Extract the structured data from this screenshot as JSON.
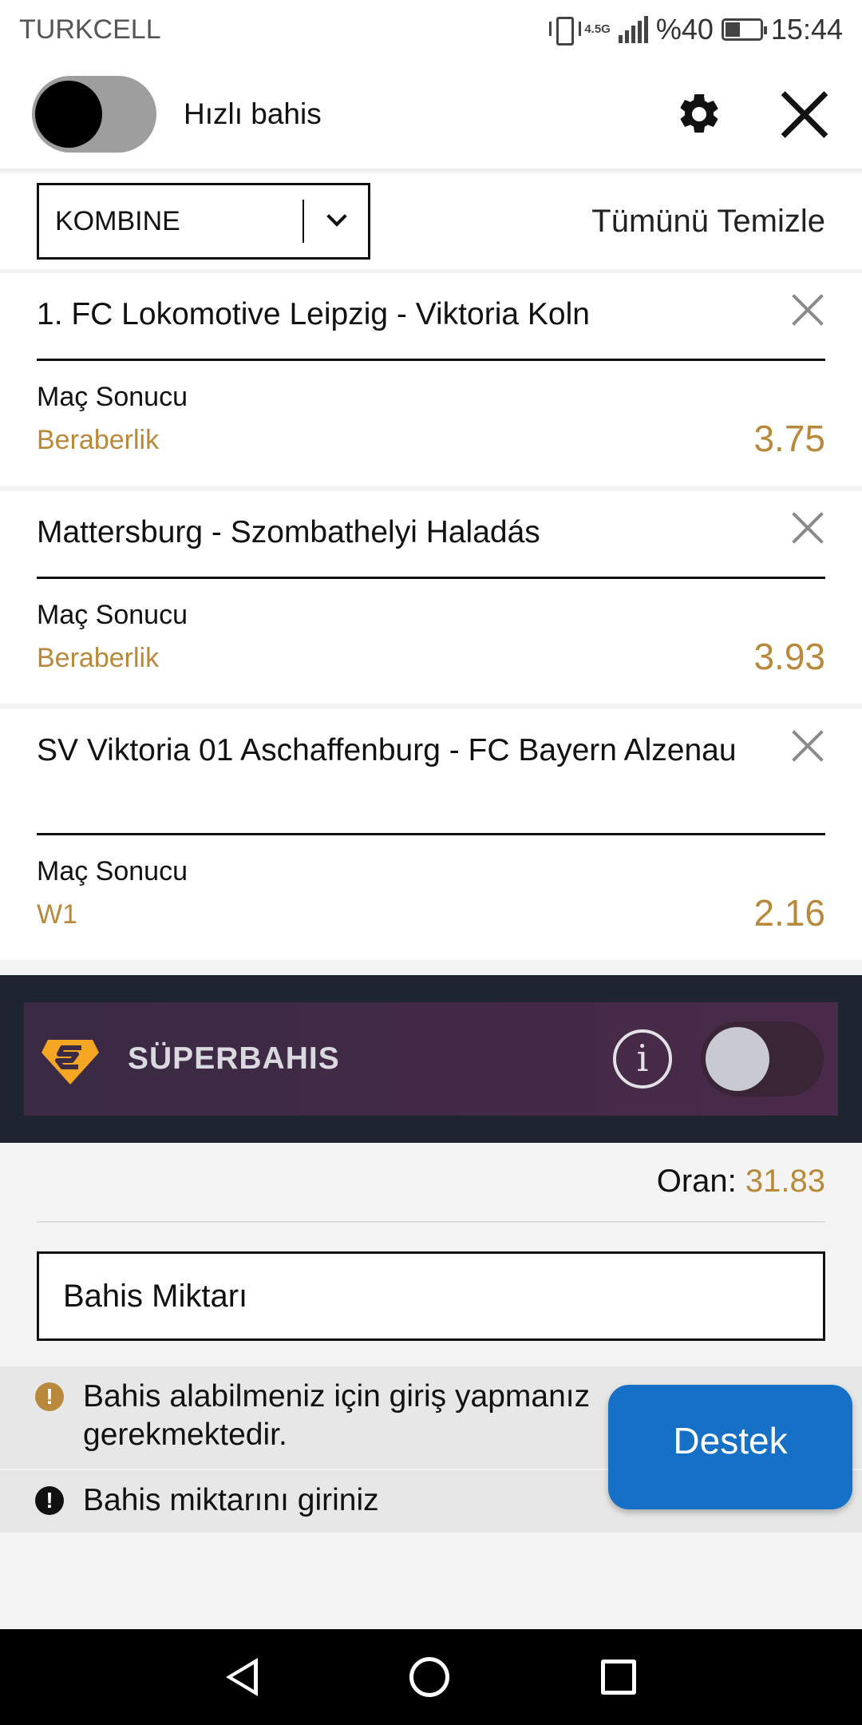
{
  "status_bar": {
    "carrier": "TURKCELL",
    "network": "4.5G",
    "battery": "%40",
    "time": "15:44"
  },
  "header": {
    "quick_bet_label": "Hızlı bahis"
  },
  "bet_type": {
    "selected": "KOMBINE",
    "clear_all": "Tümünü Temizle"
  },
  "bets": [
    {
      "match": "1. FC Lokomotive Leipzig - Viktoria Koln",
      "market": "Maç Sonucu",
      "selection": "Beraberlik",
      "odd": "3.75"
    },
    {
      "match": "Mattersburg - Szombathelyi Haladás",
      "market": "Maç Sonucu",
      "selection": "Beraberlik",
      "odd": "3.93"
    },
    {
      "match": "SV Viktoria 01 Aschaffenburg - FC Bayern Alzenau",
      "market": "Maç Sonucu",
      "selection": "W1",
      "odd": "2.16"
    }
  ],
  "superbahis": {
    "label": "SÜPERBAHIS",
    "info_glyph": "i"
  },
  "summary": {
    "oran_label": "Oran:",
    "oran_value": "31.83",
    "amount_placeholder": "Bahis Miktarı"
  },
  "messages": {
    "login_required": "Bahis alabilmeniz için giriş yapmanız gerekmektedir.",
    "enter_amount": "Bahis miktarını giriniz",
    "icon_glyph": "!"
  },
  "support_button": "Destek",
  "colors": {
    "accent_gold": "#b8893a",
    "support_blue": "#1570c6",
    "super_bg": "#1f2431"
  }
}
